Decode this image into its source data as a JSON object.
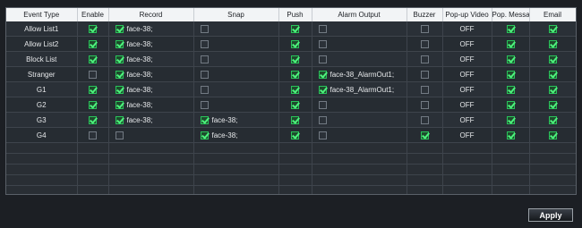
{
  "headers": [
    "Event Type",
    "Enable",
    "Record",
    "Snap",
    "Push",
    "Alarm Output",
    "Buzzer",
    "Pop-up Video",
    "Pop. Messag",
    "Email"
  ],
  "rows": [
    {
      "event": "Allow List1",
      "enable": true,
      "record": true,
      "record_text": "face-38;",
      "snap": false,
      "snap_text": "",
      "push": true,
      "alarm": false,
      "alarm_text": "",
      "buzzer": false,
      "popup": "OFF",
      "popmsg": true,
      "email": true
    },
    {
      "event": "Allow List2",
      "enable": true,
      "record": true,
      "record_text": "face-38;",
      "snap": false,
      "snap_text": "",
      "push": true,
      "alarm": false,
      "alarm_text": "",
      "buzzer": false,
      "popup": "OFF",
      "popmsg": true,
      "email": true
    },
    {
      "event": "Block List",
      "enable": true,
      "record": true,
      "record_text": "face-38;",
      "snap": false,
      "snap_text": "",
      "push": true,
      "alarm": false,
      "alarm_text": "",
      "buzzer": false,
      "popup": "OFF",
      "popmsg": true,
      "email": true
    },
    {
      "event": "Stranger",
      "enable": false,
      "record": true,
      "record_text": "face-38;",
      "snap": false,
      "snap_text": "",
      "push": true,
      "alarm": true,
      "alarm_text": "face-38_AlarmOut1;",
      "buzzer": false,
      "popup": "OFF",
      "popmsg": true,
      "email": true
    },
    {
      "event": "G1",
      "enable": true,
      "record": true,
      "record_text": "face-38;",
      "snap": false,
      "snap_text": "",
      "push": true,
      "alarm": true,
      "alarm_text": "face-38_AlarmOut1;",
      "buzzer": false,
      "popup": "OFF",
      "popmsg": true,
      "email": true
    },
    {
      "event": "G2",
      "enable": true,
      "record": true,
      "record_text": "face-38;",
      "snap": false,
      "snap_text": "",
      "push": true,
      "alarm": false,
      "alarm_text": "",
      "buzzer": false,
      "popup": "OFF",
      "popmsg": true,
      "email": true
    },
    {
      "event": "G3",
      "enable": true,
      "record": true,
      "record_text": "face-38;",
      "snap": true,
      "snap_text": "face-38;",
      "push": true,
      "alarm": false,
      "alarm_text": "",
      "buzzer": false,
      "popup": "OFF",
      "popmsg": true,
      "email": true
    },
    {
      "event": "G4",
      "enable": false,
      "record": false,
      "record_text": "",
      "snap": true,
      "snap_text": "face-38;",
      "push": true,
      "alarm": false,
      "alarm_text": "",
      "buzzer": true,
      "popup": "OFF",
      "popmsg": true,
      "email": true
    }
  ],
  "apply_label": "Apply",
  "colors": {
    "check": "#4ef27d",
    "background": "#1c1f24",
    "header": "#f2f4f6"
  }
}
